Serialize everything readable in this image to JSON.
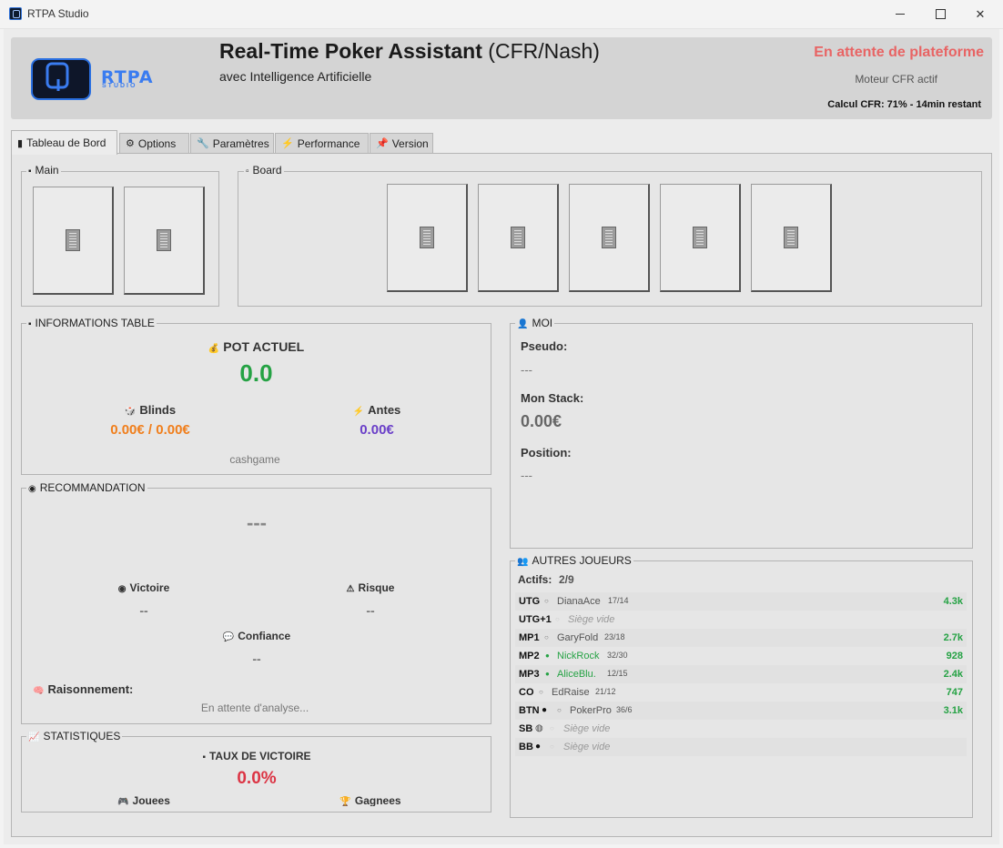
{
  "window": {
    "title": "RTPA Studio"
  },
  "header": {
    "logo_text": "RTPA",
    "logo_sub": "STUDIO",
    "title_bold": "Real-Time Poker Assistant",
    "title_rest": " (CFR/Nash)",
    "subtitle": "avec Intelligence Artificielle",
    "platform_status": "En attente de plateforme",
    "engine_status": "Moteur CFR actif",
    "cfr_calc": "Calcul CFR: 71% - 14min restant",
    "colors": {
      "platform_status": "#e86464",
      "logo": "#3a7cf0"
    }
  },
  "tabs": [
    {
      "label": "Tableau de Bord",
      "icon": "chart-icon",
      "glyph": "▮"
    },
    {
      "label": "Options",
      "icon": "gear-icon",
      "glyph": "⚙"
    },
    {
      "label": "Paramètres",
      "icon": "wrench-icon",
      "glyph": "🔧"
    },
    {
      "label": "Performance",
      "icon": "lightning-icon",
      "glyph": "⚡"
    },
    {
      "label": "Version",
      "icon": "pin-icon",
      "glyph": "📌"
    }
  ],
  "main_group": {
    "title": "Main"
  },
  "board_group": {
    "title": "Board"
  },
  "table_info": {
    "title": "INFORMATIONS TABLE",
    "pot_label": "POT ACTUEL",
    "pot_value": "0.0",
    "blinds_label": "Blinds",
    "blinds_value": "0.00€ / 0.00€",
    "antes_label": "Antes",
    "antes_value": "0.00€",
    "game_type": "cashgame"
  },
  "recommendation": {
    "title": "RECOMMANDATION",
    "action": "---",
    "victory_label": "Victoire",
    "victory_value": "--",
    "risk_label": "Risque",
    "risk_value": "--",
    "confidence_label": "Confiance",
    "confidence_value": "--",
    "reasoning_label": "Raisonnement:",
    "reasoning_value": "En attente d'analyse..."
  },
  "stats": {
    "title": "STATISTIQUES",
    "winrate_label": "TAUX DE VICTOIRE",
    "winrate_value": "0.0%",
    "played_label": "Jouees",
    "won_label": "Gagnees"
  },
  "me": {
    "title": "MOI",
    "pseudo_label": "Pseudo:",
    "pseudo_value": "---",
    "stack_label": "Mon Stack:",
    "stack_value": "0.00€",
    "position_label": "Position:",
    "position_value": "---"
  },
  "others": {
    "title": "AUTRES JOUEURS",
    "active_label": "Actifs:",
    "active_value": "2/9",
    "players": [
      {
        "pos": "UTG",
        "name": "DianaAce",
        "stats": "17/14",
        "stack": "4.3k",
        "state": "idle"
      },
      {
        "pos": "UTG+1",
        "name": "Siège vide",
        "stats": "",
        "stack": "",
        "state": "empty"
      },
      {
        "pos": "MP1",
        "name": "GaryFold",
        "stats": "23/18",
        "stack": "2.7k",
        "state": "idle"
      },
      {
        "pos": "MP2",
        "name": "NickRock",
        "stats": "32/30",
        "stack": "928",
        "state": "active"
      },
      {
        "pos": "MP3",
        "name": "AliceBlu.",
        "stats": "12/15",
        "stack": "2.4k",
        "state": "active"
      },
      {
        "pos": "CO",
        "name": "EdRaise",
        "stats": "21/12",
        "stack": "747",
        "state": "idle"
      },
      {
        "pos": "BTN",
        "name": "PokerPro",
        "stats": "36/6",
        "stack": "3.1k",
        "state": "idle"
      },
      {
        "pos": "SB",
        "name": "Siège vide",
        "stats": "",
        "stack": "",
        "state": "empty"
      },
      {
        "pos": "BB",
        "name": "Siège vide",
        "stats": "",
        "stack": "",
        "state": "empty"
      }
    ]
  },
  "colors": {
    "green": "#25a244",
    "orange": "#f07e1b",
    "purple": "#6a3fc8",
    "red": "#dc3545"
  }
}
